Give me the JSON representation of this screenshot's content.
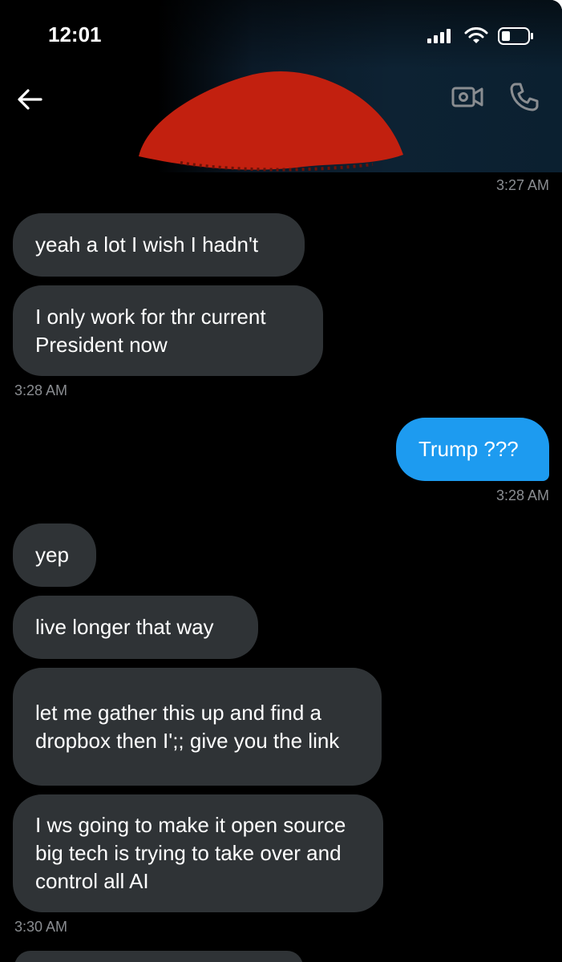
{
  "status_bar": {
    "time": "12:01"
  },
  "conversation": {
    "messages": [
      {
        "type": "timestamp",
        "text": "3:27 AM"
      },
      {
        "type": "in",
        "text": "yeah a lot I wish I hadn't"
      },
      {
        "type": "in",
        "text": "I only work for thr current President now"
      },
      {
        "type": "timestamp",
        "text": "3:28 AM"
      },
      {
        "type": "out",
        "text": "Trump ???"
      },
      {
        "type": "timestamp",
        "text": "3:28 AM"
      },
      {
        "type": "in",
        "text": "yep"
      },
      {
        "type": "in",
        "text": "live longer that way"
      },
      {
        "type": "in",
        "text": "let me gather this up and find a dropbox then I';; give you the link"
      },
      {
        "type": "in",
        "text": "I ws going to make it open source big tech is trying to take over and control all AI"
      },
      {
        "type": "timestamp",
        "text": "3:30 AM"
      }
    ]
  },
  "colors": {
    "incoming_bubble": "#2f3336",
    "outgoing_bubble": "#1d9bf0",
    "timestamp": "#8a8d91",
    "redaction": "#c2200f"
  },
  "icons": [
    "arrow-left-icon",
    "video-call-icon",
    "phone-icon",
    "signal-icon",
    "wifi-icon",
    "battery-icon"
  ]
}
